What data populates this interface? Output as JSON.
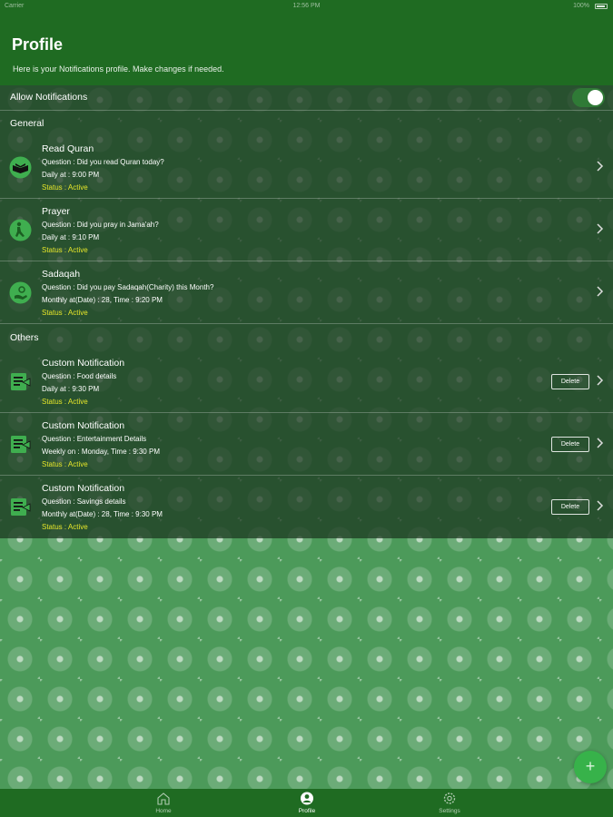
{
  "status_bar": {
    "carrier": "Carrier",
    "time": "12:56 PM",
    "battery": "100%"
  },
  "header": {
    "title": "Profile",
    "subtitle": "Here is your Notifications profile. Make changes if needed."
  },
  "allow_notifications": {
    "label": "Allow Notifications",
    "enabled": true
  },
  "sections": {
    "general": {
      "label": "General",
      "items": [
        {
          "name": "Read Quran",
          "question": "Question : Did you read Quran today?",
          "schedule": "Daily at : 9:00 PM",
          "status": "Status : Active",
          "icon": "quran-icon"
        },
        {
          "name": "Prayer",
          "question": "Question : Did you pray in Jama'ah?",
          "schedule": "Daily at : 9:10 PM",
          "status": "Status : Active",
          "icon": "prayer-icon"
        },
        {
          "name": "Sadaqah",
          "question": "Question : Did you pay Sadaqah(Charity) this Month?",
          "schedule": "Monthly at(Date) : 28, Time : 9:20 PM",
          "status": "Status : Active",
          "icon": "charity-icon"
        }
      ]
    },
    "others": {
      "label": "Others",
      "delete_label": "Delete",
      "items": [
        {
          "name": "Custom Notification",
          "question": "Question : Food details",
          "schedule": "Daily at : 9:30 PM",
          "status": "Status : Active",
          "icon": "custom-notification-icon"
        },
        {
          "name": "Custom Notification",
          "question": "Question : Entertainment Details",
          "schedule": "Weekly on : Monday, Time : 9:30 PM",
          "status": "Status : Active",
          "icon": "custom-notification-icon"
        },
        {
          "name": "Custom Notification",
          "question": "Question : Savings details",
          "schedule": "Monthly at(Date) : 28, Time : 9:30 PM",
          "status": "Status : Active",
          "icon": "custom-notification-icon"
        }
      ]
    }
  },
  "fab": {
    "label": "+"
  },
  "tabbar": {
    "tabs": [
      {
        "label": "Home",
        "icon": "home-icon",
        "active": false
      },
      {
        "label": "Profile",
        "icon": "profile-icon",
        "active": true
      },
      {
        "label": "Settings",
        "icon": "settings-icon",
        "active": false
      }
    ]
  },
  "colors": {
    "header_bg": "#1f6b22",
    "status_active": "#e6e62a",
    "fab": "#37b24a",
    "icon_green": "#3fae4f"
  }
}
